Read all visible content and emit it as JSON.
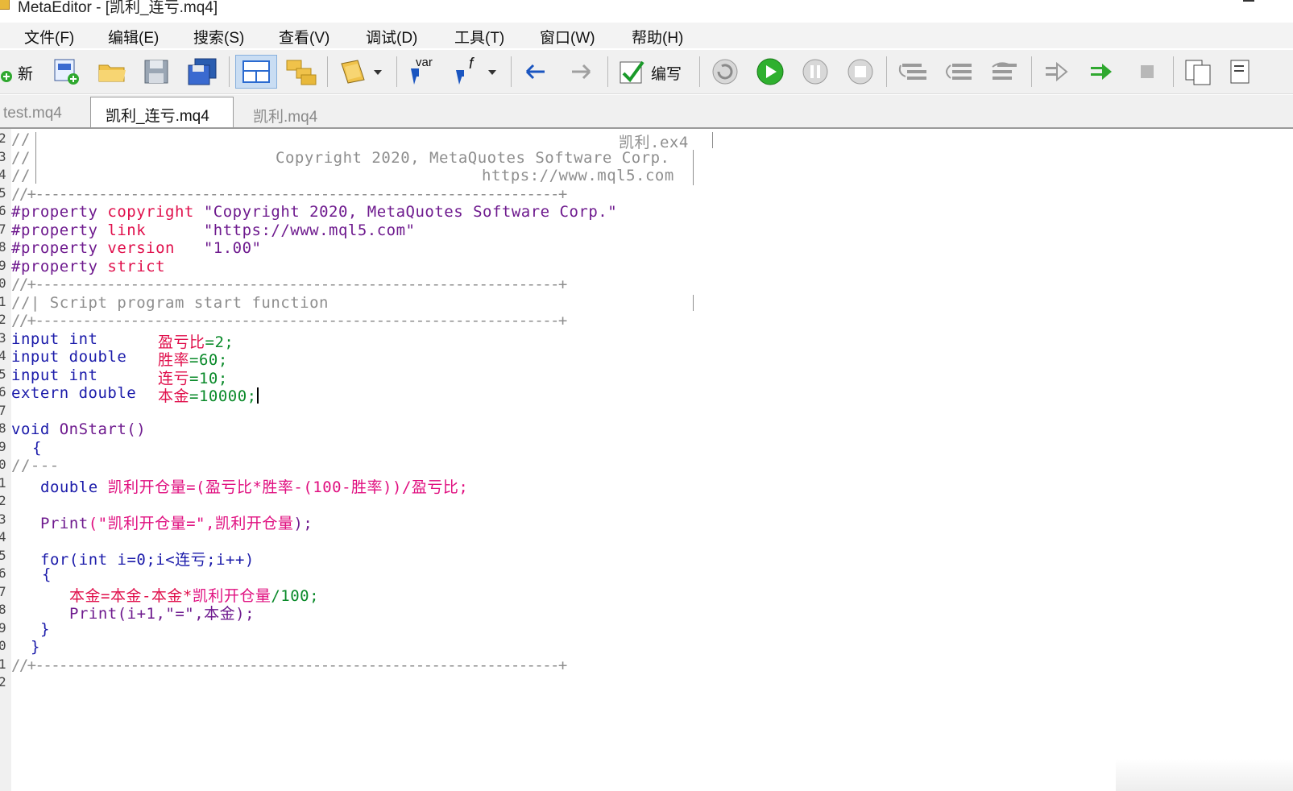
{
  "window": {
    "title": "MetaEditor - [凯利_连亏.mq4]"
  },
  "menu": [
    "文件(F)",
    "编辑(E)",
    "搜索(S)",
    "查看(V)",
    "调试(D)",
    "工具(T)",
    "窗口(W)",
    "帮助(H)"
  ],
  "toolbar": {
    "new_label": "新",
    "compile_label": "编写",
    "var_label": "var",
    "f_label": "f"
  },
  "tabs": [
    {
      "label": "test.mq4",
      "active": false
    },
    {
      "label": "凯利_连亏.mq4",
      "active": true
    },
    {
      "label": "凯利.mq4",
      "active": false
    }
  ],
  "line_numbers": [
    "2",
    "3",
    "4",
    "5",
    "6",
    "7",
    "8",
    "9",
    "0",
    "1",
    "2",
    "3",
    "4",
    "5",
    "6",
    "7",
    "8",
    "9",
    "0",
    "1",
    "2",
    "3",
    "4",
    "5",
    "6",
    "7",
    "8",
    "9",
    "0",
    "1",
    "2"
  ],
  "code": {
    "h_file": "凯利.ex4",
    "h_copy": "Copyright 2020, MetaQuotes Software Corp.",
    "h_url": "https://www.mql5.com",
    "sep": "//+------------------------------------------------------------------+",
    "c2": "//",
    "p_kw": "#property",
    "p1_name": "copyright",
    "p1_val": "\"Copyright 2020, MetaQuotes Software Corp.\"",
    "p2_name": "link",
    "p2_val": "\"https://www.mql5.com\"",
    "p3_name": "version",
    "p3_val": "\"1.00\"",
    "p4_name": "strict",
    "script_comment": "//| Script program start function",
    "in1_kw": "input int",
    "in1_var": "盈亏比",
    "in1_val": "=2;",
    "in2_kw": "input double",
    "in2_var": "胜率",
    "in2_val": "=60;",
    "in3_kw": "input int",
    "in3_var": "连亏",
    "in3_val": "=10;",
    "ext_kw": "extern double",
    "ext_var": "本金",
    "ext_val": "=10000;",
    "void_kw": "void",
    "fn_name": "OnStart()",
    "brace_open": "{",
    "short_comment": "//---",
    "d_kw": "double",
    "d_var": "凯利开仓量",
    "d_expr": "=(盈亏比*胜率-(100-胜率))/盈亏比;",
    "print_fn": "Print",
    "print1_str": "(\"凯利开仓量=\",",
    "print1_var": "凯利开仓量",
    "print1_end": ");",
    "for_kw": "for",
    "for_expr": "(int i=0;i<连亏;i++)",
    "in_brace_open": "{",
    "assign_var": "本金=本金-本金*",
    "assign_var2": "凯利开仓量",
    "assign_end": "/100;",
    "print2_args": "(i+1,\"=\",本金);",
    "in_brace_close": "}",
    "brace_close": "}"
  }
}
